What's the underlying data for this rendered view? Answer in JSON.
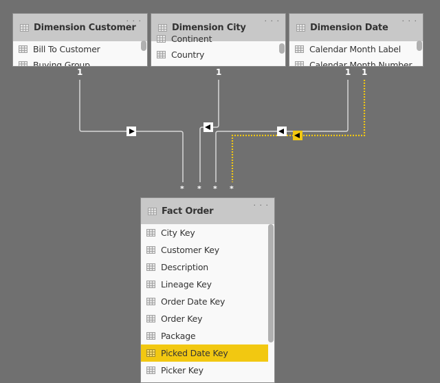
{
  "tables": {
    "customer": {
      "title": "Dimension Customer",
      "more_label": "· · ·",
      "columns": [
        "Bill To Customer",
        "Buying Group"
      ]
    },
    "city": {
      "title": "Dimension City",
      "more_label": "· · ·",
      "columns": [
        "Continent",
        "Country"
      ]
    },
    "date": {
      "title": "Dimension Date",
      "more_label": "· · ·",
      "columns": [
        "Calendar Month Label",
        "Calendar Month Number"
      ]
    },
    "fact": {
      "title": "Fact Order",
      "more_label": "· · ·",
      "columns": [
        "City Key",
        "Customer Key",
        "Description",
        "Lineage Key",
        "Order Date Key",
        "Order Key",
        "Package",
        "Picked Date Key",
        "Picker Key"
      ],
      "highlighted_column": "Picked Date Key"
    }
  },
  "relationships": [
    {
      "from": "Dimension Customer",
      "to": "Fact Order",
      "one_label": "1",
      "many_label": "*",
      "direction": "right",
      "active": true,
      "selected": false
    },
    {
      "from": "Dimension City",
      "to": "Fact Order",
      "one_label": "1",
      "many_label": "*",
      "direction": "left",
      "active": true,
      "selected": false
    },
    {
      "from": "Dimension Date",
      "to": "Fact Order",
      "one_label": "1",
      "many_label": "*",
      "direction": "left",
      "active": true,
      "selected": false
    },
    {
      "from": "Dimension Date",
      "to": "Fact Order",
      "one_label": "1",
      "many_label": "*",
      "direction": "left",
      "active": false,
      "selected": true
    }
  ],
  "colors": {
    "canvas": "#707070",
    "line": "#d8d8d8",
    "selected": "#f2c811",
    "header": "#c8c8c8"
  }
}
